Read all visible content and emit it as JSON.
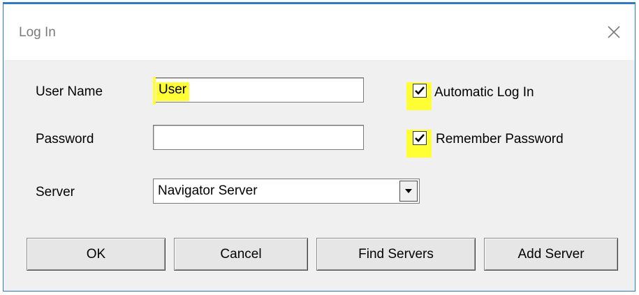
{
  "window": {
    "title": "Log In",
    "close_icon": "close-icon"
  },
  "fields": {
    "username_label": "User Name",
    "username_value": "User",
    "password_label": "Password",
    "password_value": "",
    "server_label": "Server",
    "server_value": "Navigator Server"
  },
  "options": {
    "auto_login_label": "Automatic Log In",
    "auto_login_checked": true,
    "remember_password_label": "Remember Password",
    "remember_password_checked": true
  },
  "buttons": {
    "ok": "OK",
    "cancel": "Cancel",
    "find_servers": "Find Servers",
    "add_server": "Add Server"
  },
  "colors": {
    "highlight": "#ffff33",
    "window_border": "#2b78d6"
  }
}
